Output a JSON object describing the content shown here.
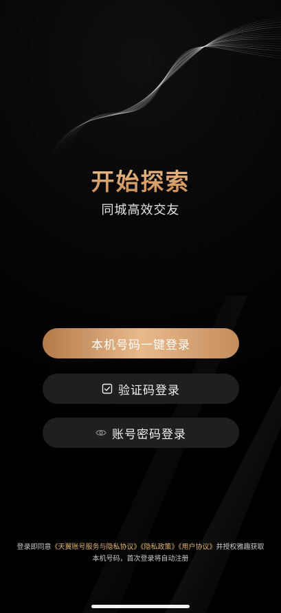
{
  "headline": "开始探索",
  "subtitle": "同城高效交友",
  "buttons": {
    "one_click": "本机号码一键登录",
    "sms_code": "验证码登录",
    "password": "账号密码登录"
  },
  "icons": {
    "sms_code": "checkbox-message-icon",
    "password": "eye-icon"
  },
  "legal": {
    "prefix": "登录即同意",
    "terms_link": "《天翼账号服务与隐私协议》",
    "privacy_link": "《隐私政策》",
    "user_link": "《用户协议》",
    "suffix": "并授权雅趣获取本机号码，首次登录将自动注册"
  },
  "colors": {
    "accent": "#d8a26d",
    "link": "#e3b36e",
    "dark_button": "#1f1f21"
  }
}
